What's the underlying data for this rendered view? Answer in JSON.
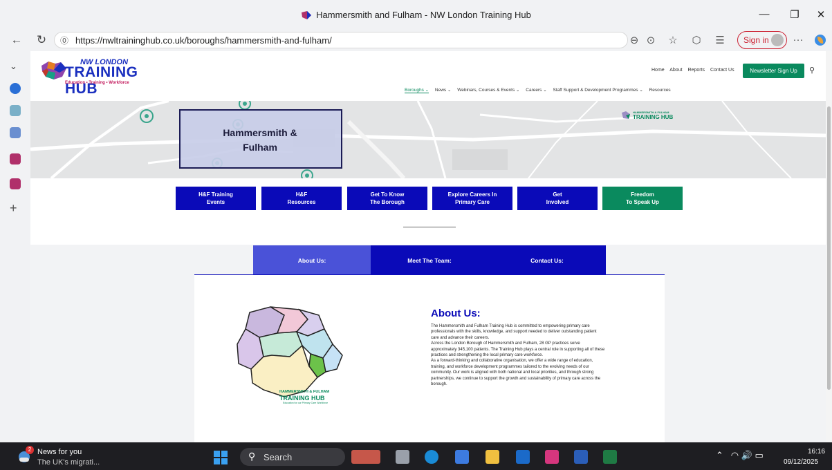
{
  "window": {
    "title": "Hammersmith and Fulham - NW London Training Hub"
  },
  "browser": {
    "url": "https://nwltraininghub.co.uk/boroughs/hammersmith-and-fulham/",
    "sign_in": "Sign in",
    "more": "···"
  },
  "site": {
    "logo": {
      "top": "NW LONDON",
      "main": "TRAINING HUB",
      "sub": "Education • Training • Workforce"
    },
    "top_links": [
      "Home",
      "About",
      "Reports",
      "Contact Us"
    ],
    "newsletter": "Newsletter Sign Up",
    "nav": [
      {
        "label": "Boroughs ⌄",
        "active": true
      },
      {
        "label": "News ⌄"
      },
      {
        "label": "Webinars, Courses & Events ⌄"
      },
      {
        "label": "Careers ⌄"
      },
      {
        "label": "Staff Support & Development Programmes ⌄"
      },
      {
        "label": "Resources"
      }
    ]
  },
  "hero": {
    "title": "Hammersmith & Fulham",
    "logo_line1": "HAMMERSMITH & FULHAM",
    "logo_line2": "TRAINING HUB"
  },
  "quick_links": [
    {
      "line1": "H&F Training",
      "line2": "Events",
      "color": "#0a0ab8"
    },
    {
      "line1": "H&F",
      "line2": "Resources",
      "color": "#0a0ab8"
    },
    {
      "line1": "Get To Know",
      "line2": "The Borough",
      "color": "#0a0ab8"
    },
    {
      "line1": "Explore Careers In",
      "line2": "Primary Care",
      "color": "#0a0ab8"
    },
    {
      "line1": "Get",
      "line2": "Involved",
      "color": "#0a0ab8"
    },
    {
      "line1": "Freedom",
      "line2": "To Speak Up",
      "color": "#0a8a5e"
    }
  ],
  "tabs": [
    {
      "label": "About Us:",
      "active": true
    },
    {
      "label": "Meet The Team:"
    },
    {
      "label": "Contact Us:"
    }
  ],
  "about": {
    "heading": "About Us:",
    "paragraphs": [
      "The Hammersmith and Fulham Training Hub is committed to empowering primary care professionals with the skills, knowledge, and support needed to deliver outstanding patient care and advance their careers.",
      "Across the London Borough of Hammersmith and Fulham, 28 GP practices serve approximately 345,100 patients. The Training Hub plays a central role in supporting all of these practices and strengthening the local primary care workforce.",
      "As a forward-thinking and collaborative organisation, we offer a wide range of education, training, and workforce development programmes tailored to the evolving needs of our community. Our work is aligned with both national and local priorities, and through strong partnerships, we continue to support the growth and sustainability of primary care across the borough."
    ],
    "illustration_logo": {
      "line1": "HAMMERSMITH & FULHAM",
      "line2": "TRAINING HUB",
      "line3": "Education for our Primary Care Workforce"
    }
  },
  "taskbar": {
    "news_badge": "2",
    "news_title": "News for you",
    "news_sub": "The UK's migrati...",
    "search": "Search",
    "time": "16:16",
    "date": "09/12/2025"
  },
  "colors": {
    "brand_blue": "#0a0ab8",
    "brand_green": "#0a8a5e",
    "tab_active": "#4a52d8"
  }
}
